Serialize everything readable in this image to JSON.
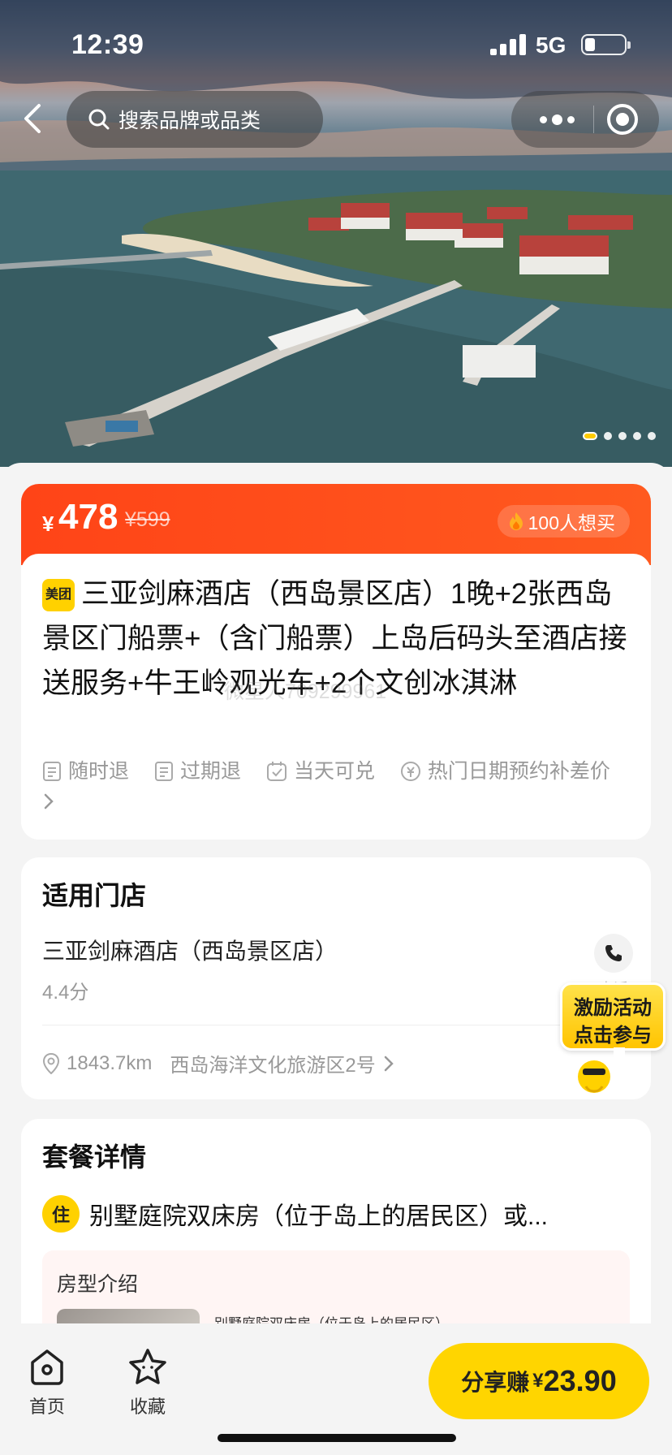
{
  "status_bar": {
    "time": "12:39",
    "network": "5G"
  },
  "nav": {
    "search_placeholder": "搜索品牌或品类"
  },
  "hero": {
    "image_count": 5,
    "active_index": 0
  },
  "product": {
    "currency": "¥",
    "price": "478",
    "original_price": "¥599",
    "want_count": "100人想买",
    "brand_tag": "美团",
    "title": "三亚剑麻酒店（西岛景区店）1晚+2张西岛景区门船票+（含门船票）上岛后码头至酒店接送服务+牛王岭观光车+2个文创冰淇淋",
    "watermark": "微星人709299961",
    "policies": [
      "随时退",
      "过期退",
      "当天可兑",
      "热门日期预约补差价"
    ]
  },
  "store": {
    "section_title": "适用门店",
    "name": "三亚剑麻酒店（西岛景区店）",
    "score": "4.4分",
    "phone_label": "电话",
    "distance": "1843.7km",
    "address": "西岛海洋文化旅游区2号"
  },
  "promo": {
    "line1": "激励活动",
    "line2": "点击参与"
  },
  "package": {
    "section_title": "套餐详情",
    "tag": "住",
    "room_name": "别墅庭院双床房（位于岛上的居民区）或...",
    "room_intro_title": "房型介绍",
    "room_intro_name": "别墅庭院双床房（位于岛上的居民区）"
  },
  "tabbar": {
    "home_label": "首页",
    "fav_label": "收藏",
    "share_label": "分享赚",
    "share_currency": "¥",
    "share_amount": "23.90"
  },
  "colors": {
    "accent_orange": "#ff4417",
    "brand_yellow": "#ffd500"
  }
}
